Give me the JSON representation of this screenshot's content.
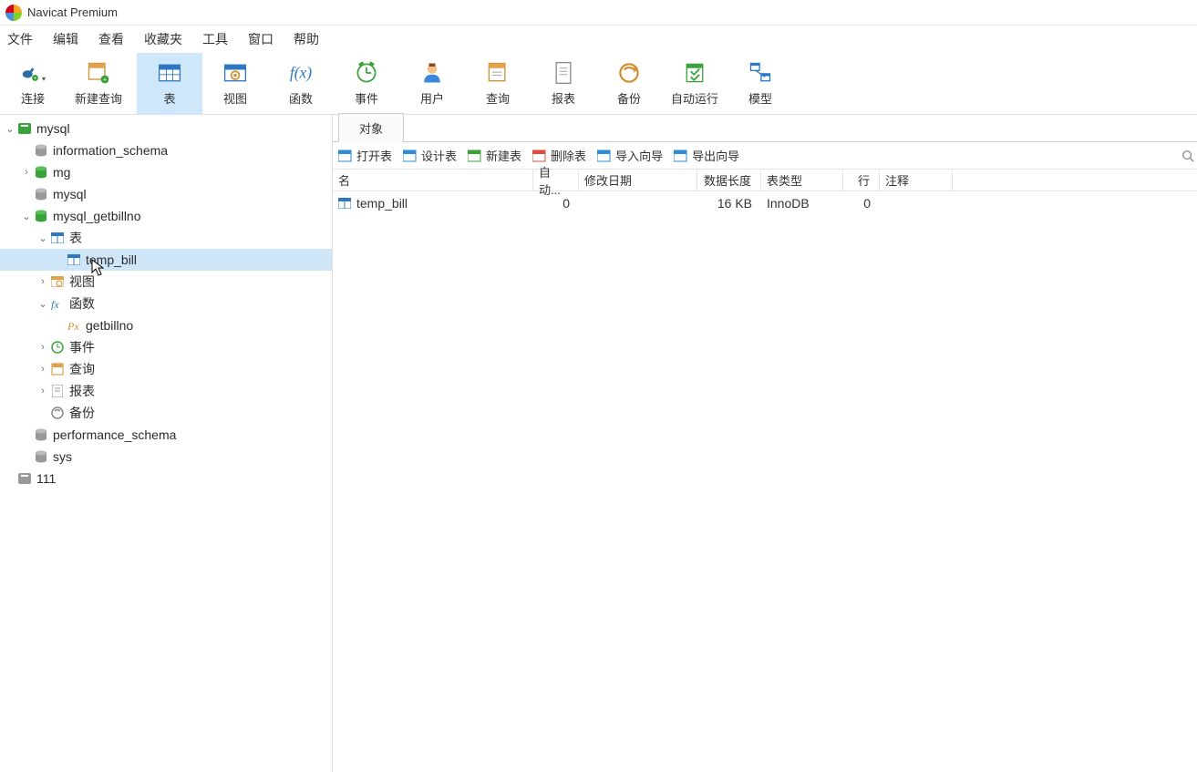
{
  "window": {
    "title": "Navicat Premium"
  },
  "menu": [
    "文件",
    "编辑",
    "查看",
    "收藏夹",
    "工具",
    "窗口",
    "帮助"
  ],
  "toolbar": [
    {
      "id": "connect",
      "label": "连接",
      "icon": "plug",
      "dropdown": true
    },
    {
      "id": "newquery",
      "label": "新建查询",
      "icon": "newquery"
    },
    {
      "id": "table",
      "label": "表",
      "icon": "table",
      "active": true
    },
    {
      "id": "view",
      "label": "视图",
      "icon": "view"
    },
    {
      "id": "function",
      "label": "函数",
      "icon": "fx"
    },
    {
      "id": "event",
      "label": "事件",
      "icon": "clock"
    },
    {
      "id": "user",
      "label": "用户",
      "icon": "user"
    },
    {
      "id": "query",
      "label": "查询",
      "icon": "query"
    },
    {
      "id": "report",
      "label": "报表",
      "icon": "report"
    },
    {
      "id": "backup",
      "label": "备份",
      "icon": "backup"
    },
    {
      "id": "autorun",
      "label": "自动运行",
      "icon": "autorun"
    },
    {
      "id": "model",
      "label": "模型",
      "icon": "model"
    }
  ],
  "tree": {
    "root": [
      {
        "label": "mysql",
        "icon": "conn-green",
        "expand": "open",
        "indent": 0,
        "children": [
          {
            "label": "information_schema",
            "icon": "db-gray",
            "indent": 1
          },
          {
            "label": "mg",
            "icon": "db-green",
            "expand": "closed",
            "indent": 1
          },
          {
            "label": "mysql",
            "icon": "db-gray",
            "indent": 1
          },
          {
            "label": "mysql_getbillno",
            "icon": "db-green",
            "expand": "open",
            "indent": 1,
            "children": [
              {
                "label": "表",
                "icon": "tbl-blue",
                "expand": "open",
                "indent": 2,
                "children": [
                  {
                    "label": "temp_bill",
                    "icon": "tbl-blue",
                    "indent": 3,
                    "selected": true
                  }
                ]
              },
              {
                "label": "视图",
                "icon": "view-orange",
                "expand": "closed",
                "indent": 2
              },
              {
                "label": "函数",
                "icon": "fx-blue",
                "expand": "open",
                "indent": 2,
                "children": [
                  {
                    "label": "getbillno",
                    "icon": "px-orange",
                    "indent": 3
                  }
                ]
              },
              {
                "label": "事件",
                "icon": "clock-green",
                "expand": "closed",
                "indent": 2
              },
              {
                "label": "查询",
                "icon": "query-orange",
                "expand": "closed",
                "indent": 2
              },
              {
                "label": "报表",
                "icon": "report-gray",
                "expand": "closed",
                "indent": 2
              },
              {
                "label": "备份",
                "icon": "backup-gray",
                "indent": 2
              }
            ]
          },
          {
            "label": "performance_schema",
            "icon": "db-gray",
            "indent": 1
          },
          {
            "label": "sys",
            "icon": "db-gray",
            "indent": 1
          }
        ]
      },
      {
        "label": "111",
        "icon": "conn-gray",
        "indent": 0
      }
    ]
  },
  "tab": {
    "label": "对象"
  },
  "objectbar": [
    {
      "id": "open",
      "label": "打开表",
      "iconColor": "#2e8bd8"
    },
    {
      "id": "design",
      "label": "设计表",
      "iconColor": "#2e8bd8"
    },
    {
      "id": "new",
      "label": "新建表",
      "iconColor": "#3aa23a"
    },
    {
      "id": "delete",
      "label": "删除表",
      "iconColor": "#d84e3a"
    },
    {
      "id": "import",
      "label": "导入向导",
      "iconColor": "#2e8bd8"
    },
    {
      "id": "export",
      "label": "导出向导",
      "iconColor": "#2e8bd8"
    }
  ],
  "columns": {
    "name": "名",
    "auto": "自动...",
    "moddate": "修改日期",
    "datalen": "数据长度",
    "tbltype": "表类型",
    "rows": "行",
    "comment": "注释"
  },
  "rows": [
    {
      "name": "temp_bill",
      "auto": "0",
      "moddate": "",
      "datalen": "16 KB",
      "tbltype": "InnoDB",
      "rows": "0",
      "comment": ""
    }
  ],
  "colwidths": {
    "name": 220,
    "auto": 50,
    "moddate": 130,
    "datalen": 70,
    "tbltype": 90,
    "rows": 40,
    "comment": 80
  }
}
